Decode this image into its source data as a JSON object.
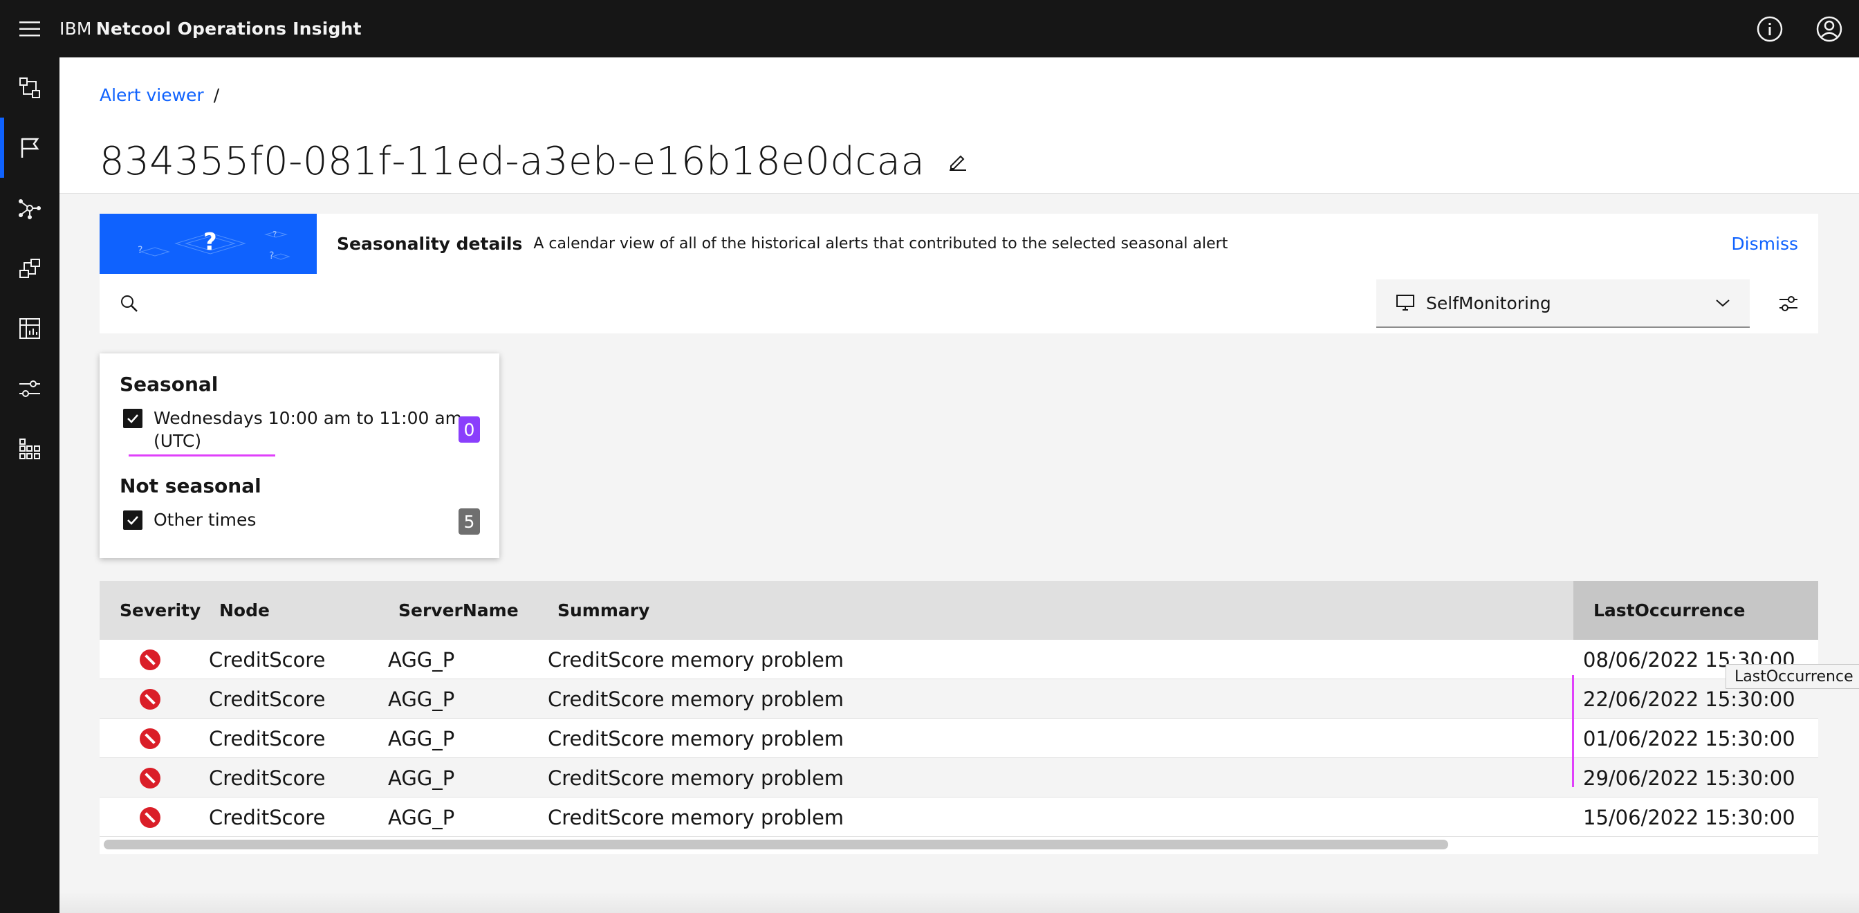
{
  "app": {
    "brand_prefix": "IBM",
    "brand_name": "Netcool Operations Insight"
  },
  "breadcrumb": {
    "parent": "Alert viewer",
    "separator": "/"
  },
  "page": {
    "title": "834355f0-081f-11ed-a3eb-e16b18e0dcaa"
  },
  "banner": {
    "title": "Seasonality details",
    "description": "A calendar view of all of the historical alerts that contributed to the selected seasonal alert",
    "dismiss_label": "Dismiss"
  },
  "toolbar": {
    "search_placeholder": "",
    "dropdown_selected": "SelfMonitoring"
  },
  "filters": {
    "seasonal": {
      "title": "Seasonal",
      "option_line1": "Wednesdays 10:00 am to 11:00 am",
      "option_line2": "(UTC)",
      "checked": true,
      "count": "0",
      "count_color": "#8a3ffc"
    },
    "not_seasonal": {
      "title": "Not seasonal",
      "option_label": "Other times",
      "checked": true,
      "count": "5",
      "count_color": "#6f6f6f"
    }
  },
  "table": {
    "columns": [
      "Severity",
      "Node",
      "ServerName",
      "Summary",
      "LastOccurrence"
    ],
    "sorted_column": "LastOccurrence",
    "rows": [
      {
        "severity": "critical",
        "node": "CreditScore",
        "server": "AGG_P",
        "summary": "CreditScore memory problem",
        "last": "08/06/2022 15:30:00"
      },
      {
        "severity": "critical",
        "node": "CreditScore",
        "server": "AGG_P",
        "summary": "CreditScore memory problem",
        "last": "22/06/2022 15:30:00"
      },
      {
        "severity": "critical",
        "node": "CreditScore",
        "server": "AGG_P",
        "summary": "CreditScore memory problem",
        "last": "01/06/2022 15:30:00"
      },
      {
        "severity": "critical",
        "node": "CreditScore",
        "server": "AGG_P",
        "summary": "CreditScore memory problem",
        "last": "29/06/2022 15:30:00"
      },
      {
        "severity": "critical",
        "node": "CreditScore",
        "server": "AGG_P",
        "summary": "CreditScore memory problem",
        "last": "15/06/2022 15:30:00"
      }
    ],
    "tooltip": "LastOccurrence"
  },
  "icons": {
    "menu": "hamburger-icon",
    "info": "info-icon",
    "user": "user-avatar-icon",
    "nav": [
      "topology-icon",
      "flag-icon",
      "network-icon",
      "flow-icon",
      "calendar-chart-icon",
      "sliders-icon",
      "grid-icon"
    ],
    "search": "search-icon",
    "monitor": "monitor-icon",
    "chevron": "chevron-down-icon",
    "settings": "settings-adjust-icon",
    "edit": "edit-icon",
    "severity": "critical-severity-icon"
  },
  "colors": {
    "accent": "#0f62fe",
    "critical": "#da1e28",
    "annotation": "#e040fb"
  }
}
